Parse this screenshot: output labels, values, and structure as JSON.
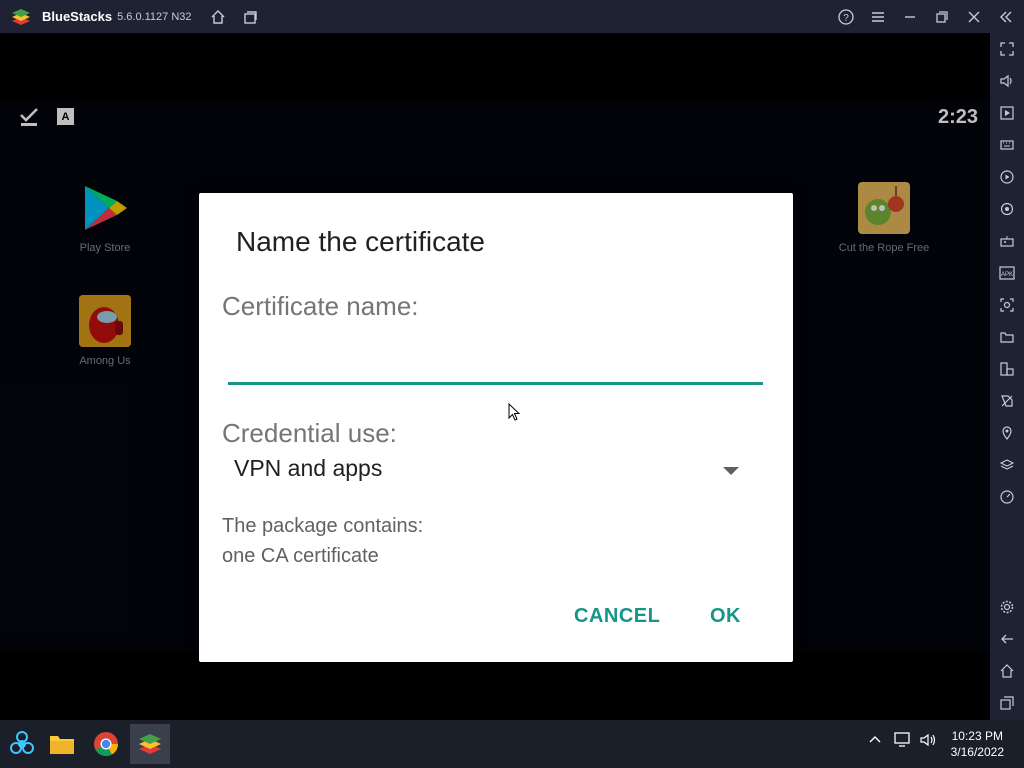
{
  "window": {
    "app_name": "BlueStacks",
    "version": "5.6.0.1127 N32"
  },
  "android": {
    "clock": "2:23",
    "apps": [
      {
        "label": "Play Store"
      },
      {
        "label": "Among Us"
      },
      {
        "label": "Cut the Rope Free"
      }
    ]
  },
  "dialog": {
    "title": "Name the certificate",
    "cert_name_label": "Certificate name:",
    "cert_name_value": "",
    "credential_label": "Credential use:",
    "credential_value": "VPN and apps",
    "info_line1": "The package contains:",
    "info_line2": "one CA certificate",
    "cancel_label": "CANCEL",
    "ok_label": "OK"
  },
  "taskbar": {
    "time": "10:23 PM",
    "date": "3/16/2022"
  },
  "colors": {
    "accent": "#159688",
    "titlebar": "#1f2233",
    "taskbar": "#1b1f2a"
  }
}
